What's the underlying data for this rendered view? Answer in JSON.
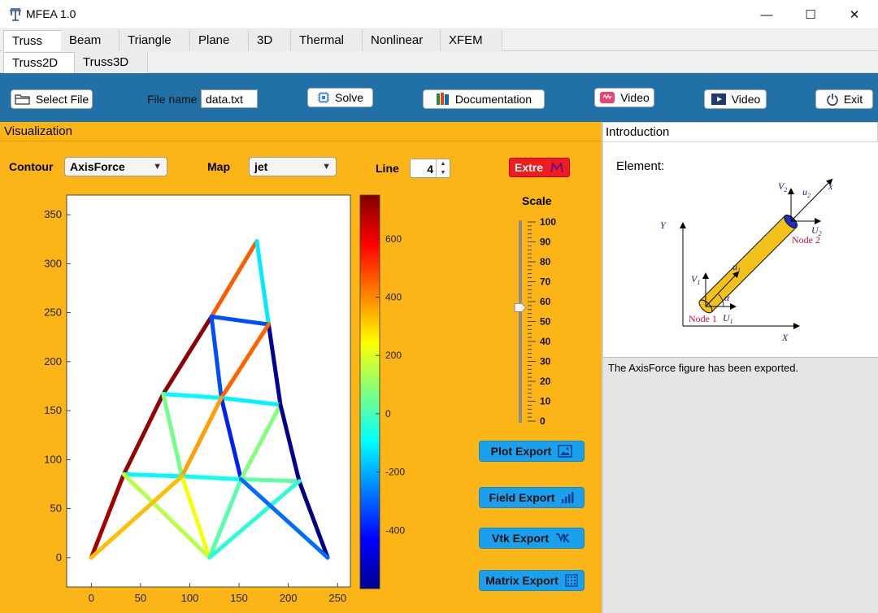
{
  "app": {
    "title": "MFEA 1.0",
    "minimize": "—",
    "maximize": "☐",
    "close": "✕"
  },
  "tabs": [
    "Truss",
    "Beam",
    "Triangle",
    "Plane",
    "3D",
    "Thermal",
    "Nonlinear",
    "XFEM"
  ],
  "subtabs": [
    "Truss2D",
    "Truss3D"
  ],
  "toolbar": {
    "select_file": "Select File",
    "file_name_label": "File name",
    "file_name_value": "data.txt",
    "solve": "Solve",
    "documentation": "Documentation",
    "video1": "Video",
    "video2": "Video",
    "exit": "Exit"
  },
  "visualization": {
    "header": "Visualization",
    "contour_label": "Contour",
    "contour_value": "AxisForce",
    "map_label": "Map",
    "map_value": "jet",
    "line_label": "Line",
    "line_value": "4",
    "extre_label": "Extre",
    "scale_label": "Scale",
    "scale_value": 57
  },
  "exports": {
    "plot": "Plot Export",
    "field": "Field Export",
    "vtk": "Vtk Export",
    "matrix": "Matrix Export"
  },
  "introduction": {
    "header": "Introduction",
    "element_label": "Element:",
    "diagram": {
      "V2": "V",
      "V2_sub": "2",
      "u2": "u",
      "u2_sub": "2",
      "x": "x",
      "U2": "U",
      "U2_sub": "2",
      "node2": "Node 2",
      "Y": "Y",
      "X": "X",
      "V1": "V",
      "V1_sub": "1",
      "u1": "u",
      "u1_sub": "1",
      "alpha": "α",
      "U1": "U",
      "U1_sub": "1",
      "node1": "Node 1"
    }
  },
  "status": {
    "message": "The AxisForce figure has been exported."
  },
  "chart_data": {
    "type": "line",
    "title": "",
    "xlabel": "",
    "ylabel": "",
    "xlim": [
      -25,
      263
    ],
    "ylim": [
      -30,
      370
    ],
    "xticks": [
      0,
      50,
      100,
      150,
      200,
      250
    ],
    "yticks": [
      0,
      50,
      100,
      150,
      200,
      250,
      300,
      350
    ],
    "colorbar": {
      "colormap": "jet",
      "range": [
        -600,
        750
      ],
      "ticks": [
        600,
        400,
        200,
        0,
        -200,
        -400
      ]
    },
    "members": [
      {
        "x": [
          0,
          33
        ],
        "y": [
          0,
          85
        ],
        "value": 700
      },
      {
        "x": [
          33,
          73
        ],
        "y": [
          85,
          167
        ],
        "value": 720
      },
      {
        "x": [
          73,
          122
        ],
        "y": [
          167,
          246
        ],
        "value": 730
      },
      {
        "x": [
          122,
          168
        ],
        "y": [
          246,
          323
        ],
        "value": 460
      },
      {
        "x": [
          168,
          180
        ],
        "y": [
          323,
          238
        ],
        "value": -120
      },
      {
        "x": [
          122,
          180
        ],
        "y": [
          246,
          238
        ],
        "value": -330
      },
      {
        "x": [
          122,
          132
        ],
        "y": [
          246,
          163
        ],
        "value": -330
      },
      {
        "x": [
          180,
          192
        ],
        "y": [
          238,
          156
        ],
        "value": -570
      },
      {
        "x": [
          132,
          180
        ],
        "y": [
          163,
          238
        ],
        "value": 450
      },
      {
        "x": [
          73,
          132
        ],
        "y": [
          167,
          163
        ],
        "value": -100
      },
      {
        "x": [
          132,
          192
        ],
        "y": [
          163,
          156
        ],
        "value": -110
      },
      {
        "x": [
          73,
          92
        ],
        "y": [
          167,
          83
        ],
        "value": 60
      },
      {
        "x": [
          132,
          152
        ],
        "y": [
          163,
          80
        ],
        "value": -390
      },
      {
        "x": [
          152,
          192
        ],
        "y": [
          80,
          156
        ],
        "value": 80
      },
      {
        "x": [
          92,
          132
        ],
        "y": [
          83,
          163
        ],
        "value": 370
      },
      {
        "x": [
          33,
          92
        ],
        "y": [
          85,
          83
        ],
        "value": -100
      },
      {
        "x": [
          92,
          152
        ],
        "y": [
          83,
          80
        ],
        "value": -80
      },
      {
        "x": [
          152,
          211
        ],
        "y": [
          80,
          78
        ],
        "value": 30
      },
      {
        "x": [
          192,
          211
        ],
        "y": [
          156,
          78
        ],
        "value": -580
      },
      {
        "x": [
          211,
          240
        ],
        "y": [
          78,
          0
        ],
        "value": -600
      },
      {
        "x": [
          33,
          120
        ],
        "y": [
          85,
          0
        ],
        "value": 150
      },
      {
        "x": [
          92,
          120
        ],
        "y": [
          83,
          0
        ],
        "value": 230
      },
      {
        "x": [
          120,
          152
        ],
        "y": [
          0,
          80
        ],
        "value": 20
      },
      {
        "x": [
          120,
          211
        ],
        "y": [
          0,
          78
        ],
        "value": -40
      },
      {
        "x": [
          152,
          240
        ],
        "y": [
          80,
          0
        ],
        "value": -290
      },
      {
        "x": [
          0,
          92
        ],
        "y": [
          0,
          83
        ],
        "value": 330
      }
    ]
  }
}
